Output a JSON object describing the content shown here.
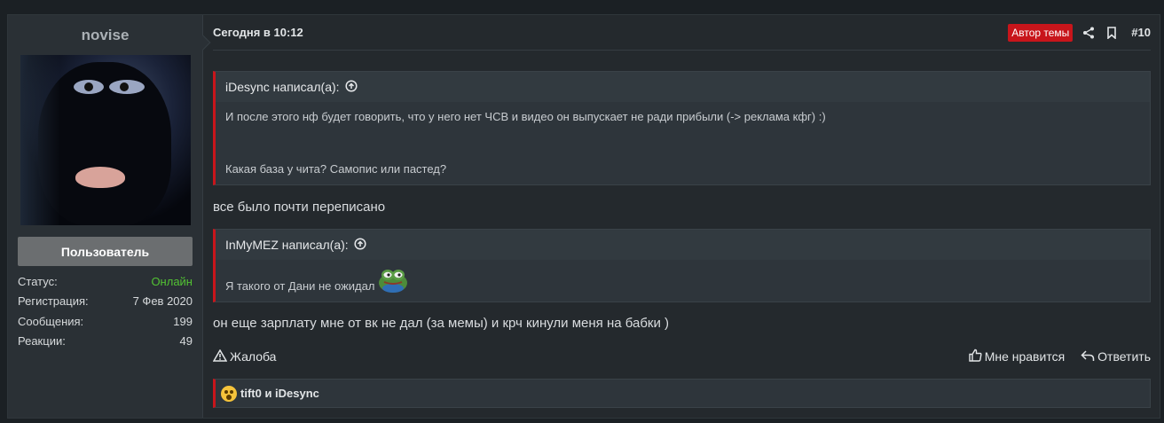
{
  "user": {
    "name": "novise",
    "role": "Пользователь",
    "stats": [
      {
        "label": "Статус:",
        "value": "Онлайн"
      },
      {
        "label": "Регистрация:",
        "value": "7 Фев 2020"
      },
      {
        "label": "Сообщения:",
        "value": "199"
      },
      {
        "label": "Реакции:",
        "value": "49"
      }
    ]
  },
  "post": {
    "date": "Сегодня в 10:12",
    "author_badge": "Автор темы",
    "number": "#10",
    "quote1": {
      "author": "iDesync написал(а):",
      "line1": "И после этого нф будет говорить, что у него нет ЧСВ и видео он выпускает не ради прибыли (-> реклама кфг) :)",
      "line2": "Какая база у чита? Самопис или пастед?"
    },
    "reply1": "все было почти переписано",
    "quote2": {
      "author": "InMyMEZ написал(а):",
      "text": "Я такого от Дани не ожидал"
    },
    "reply2": "он еще зарплату мне от вк не дал (за мемы) и крч кинули меня на бабки )",
    "actions": {
      "report": "Жалоба",
      "like": "Мне нравится",
      "reply": "Ответить"
    },
    "likes": "tift0 и iDesync"
  },
  "colors": {
    "accent": "#c8151b",
    "online": "#52c233"
  },
  "icons": [
    "share-icon",
    "bookmark-icon",
    "arrow-up-circle-icon",
    "warning-icon",
    "thumbs-up-icon",
    "reply-icon",
    "emoji-surprised-icon",
    "pepe-emoji-icon"
  ]
}
